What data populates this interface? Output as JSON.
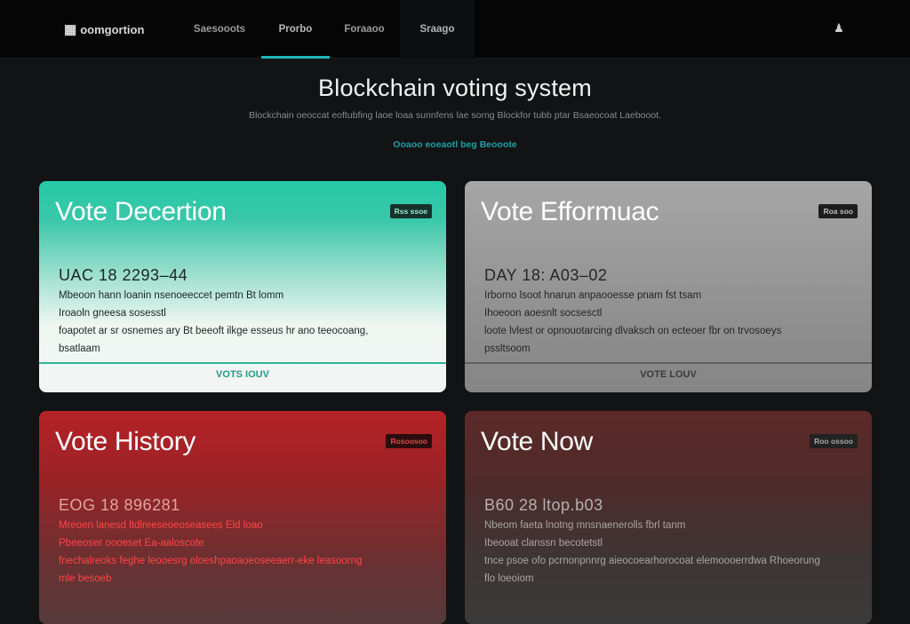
{
  "nav": {
    "brand": "oomgortion",
    "items": [
      "Saesooots",
      "Prorbo",
      "Foraaoo",
      "Sraago"
    ]
  },
  "hero": {
    "title": "Blockchain voting system",
    "subtitle": "Blockchain oeoccat eoftubfing laoe loaa sunnfens lae sorng Blockfor tubb ptar Bsaeocoat Laebooot.",
    "cta": "Ooaoo eoeaotl beg Beooote"
  },
  "cards": [
    {
      "title": "Vote Decertion",
      "badge": "Rss ssoe",
      "date": "UAC 18 2293–44",
      "lines": [
        "Mbeoon hann loanin nsenoeeccet pemtn Bt lomm",
        "Iroaoln gneesa sosesstl",
        "foapotet ar sr osnemes ary Bt beeoft ilkge esseus hr ano teeocoang,",
        "bsatlaam"
      ],
      "vote": "VOTS IOUV"
    },
    {
      "title": "Vote Efformuac",
      "badge": "Roa soo",
      "date": "DAY 18: A03–02",
      "lines": [
        "Irborno lsoot hnarun anpaooesse pnam fst tsam",
        "Ihoeoon aoesnlt socsesctl",
        "loote lvlest or opnouotarcing dlvaksch on ecteoer fbr on trvosoeys",
        "pssltsoom"
      ],
      "vote": "VOTE LOUV"
    },
    {
      "title": "Vote History",
      "badge": "Rosoosoo",
      "date": "EOG 18 896281",
      "lines": [
        "Mreoen lanesd ltdlreeseoeoseasees Eld loao",
        "Pbeeoser oooeset Ea-aaloscote",
        "fnechalreoks feghe leooesrg oloeshpaoaoeoseeaerr-eke leasoorng",
        "mle besoeb"
      ],
      "vote": ""
    },
    {
      "title": "Vote Now",
      "badge": "Roo ossoo",
      "date": "B60 28 ltop.b03",
      "lines": [
        "Nbeom faeta lnotng mnsnaenerolls fbrl tanm",
        "Ibeooat clanssn becotetstl",
        "tnce psoe ofo pcrnonpnnrg aieocoearhorocoat elemoooerrdwa Rhoeorung",
        "flo loeoiom"
      ],
      "vote": ""
    }
  ],
  "colors": {
    "accent": "#1fb6b9",
    "teal_card": "#25c9a6",
    "red_card": "#b42226"
  }
}
